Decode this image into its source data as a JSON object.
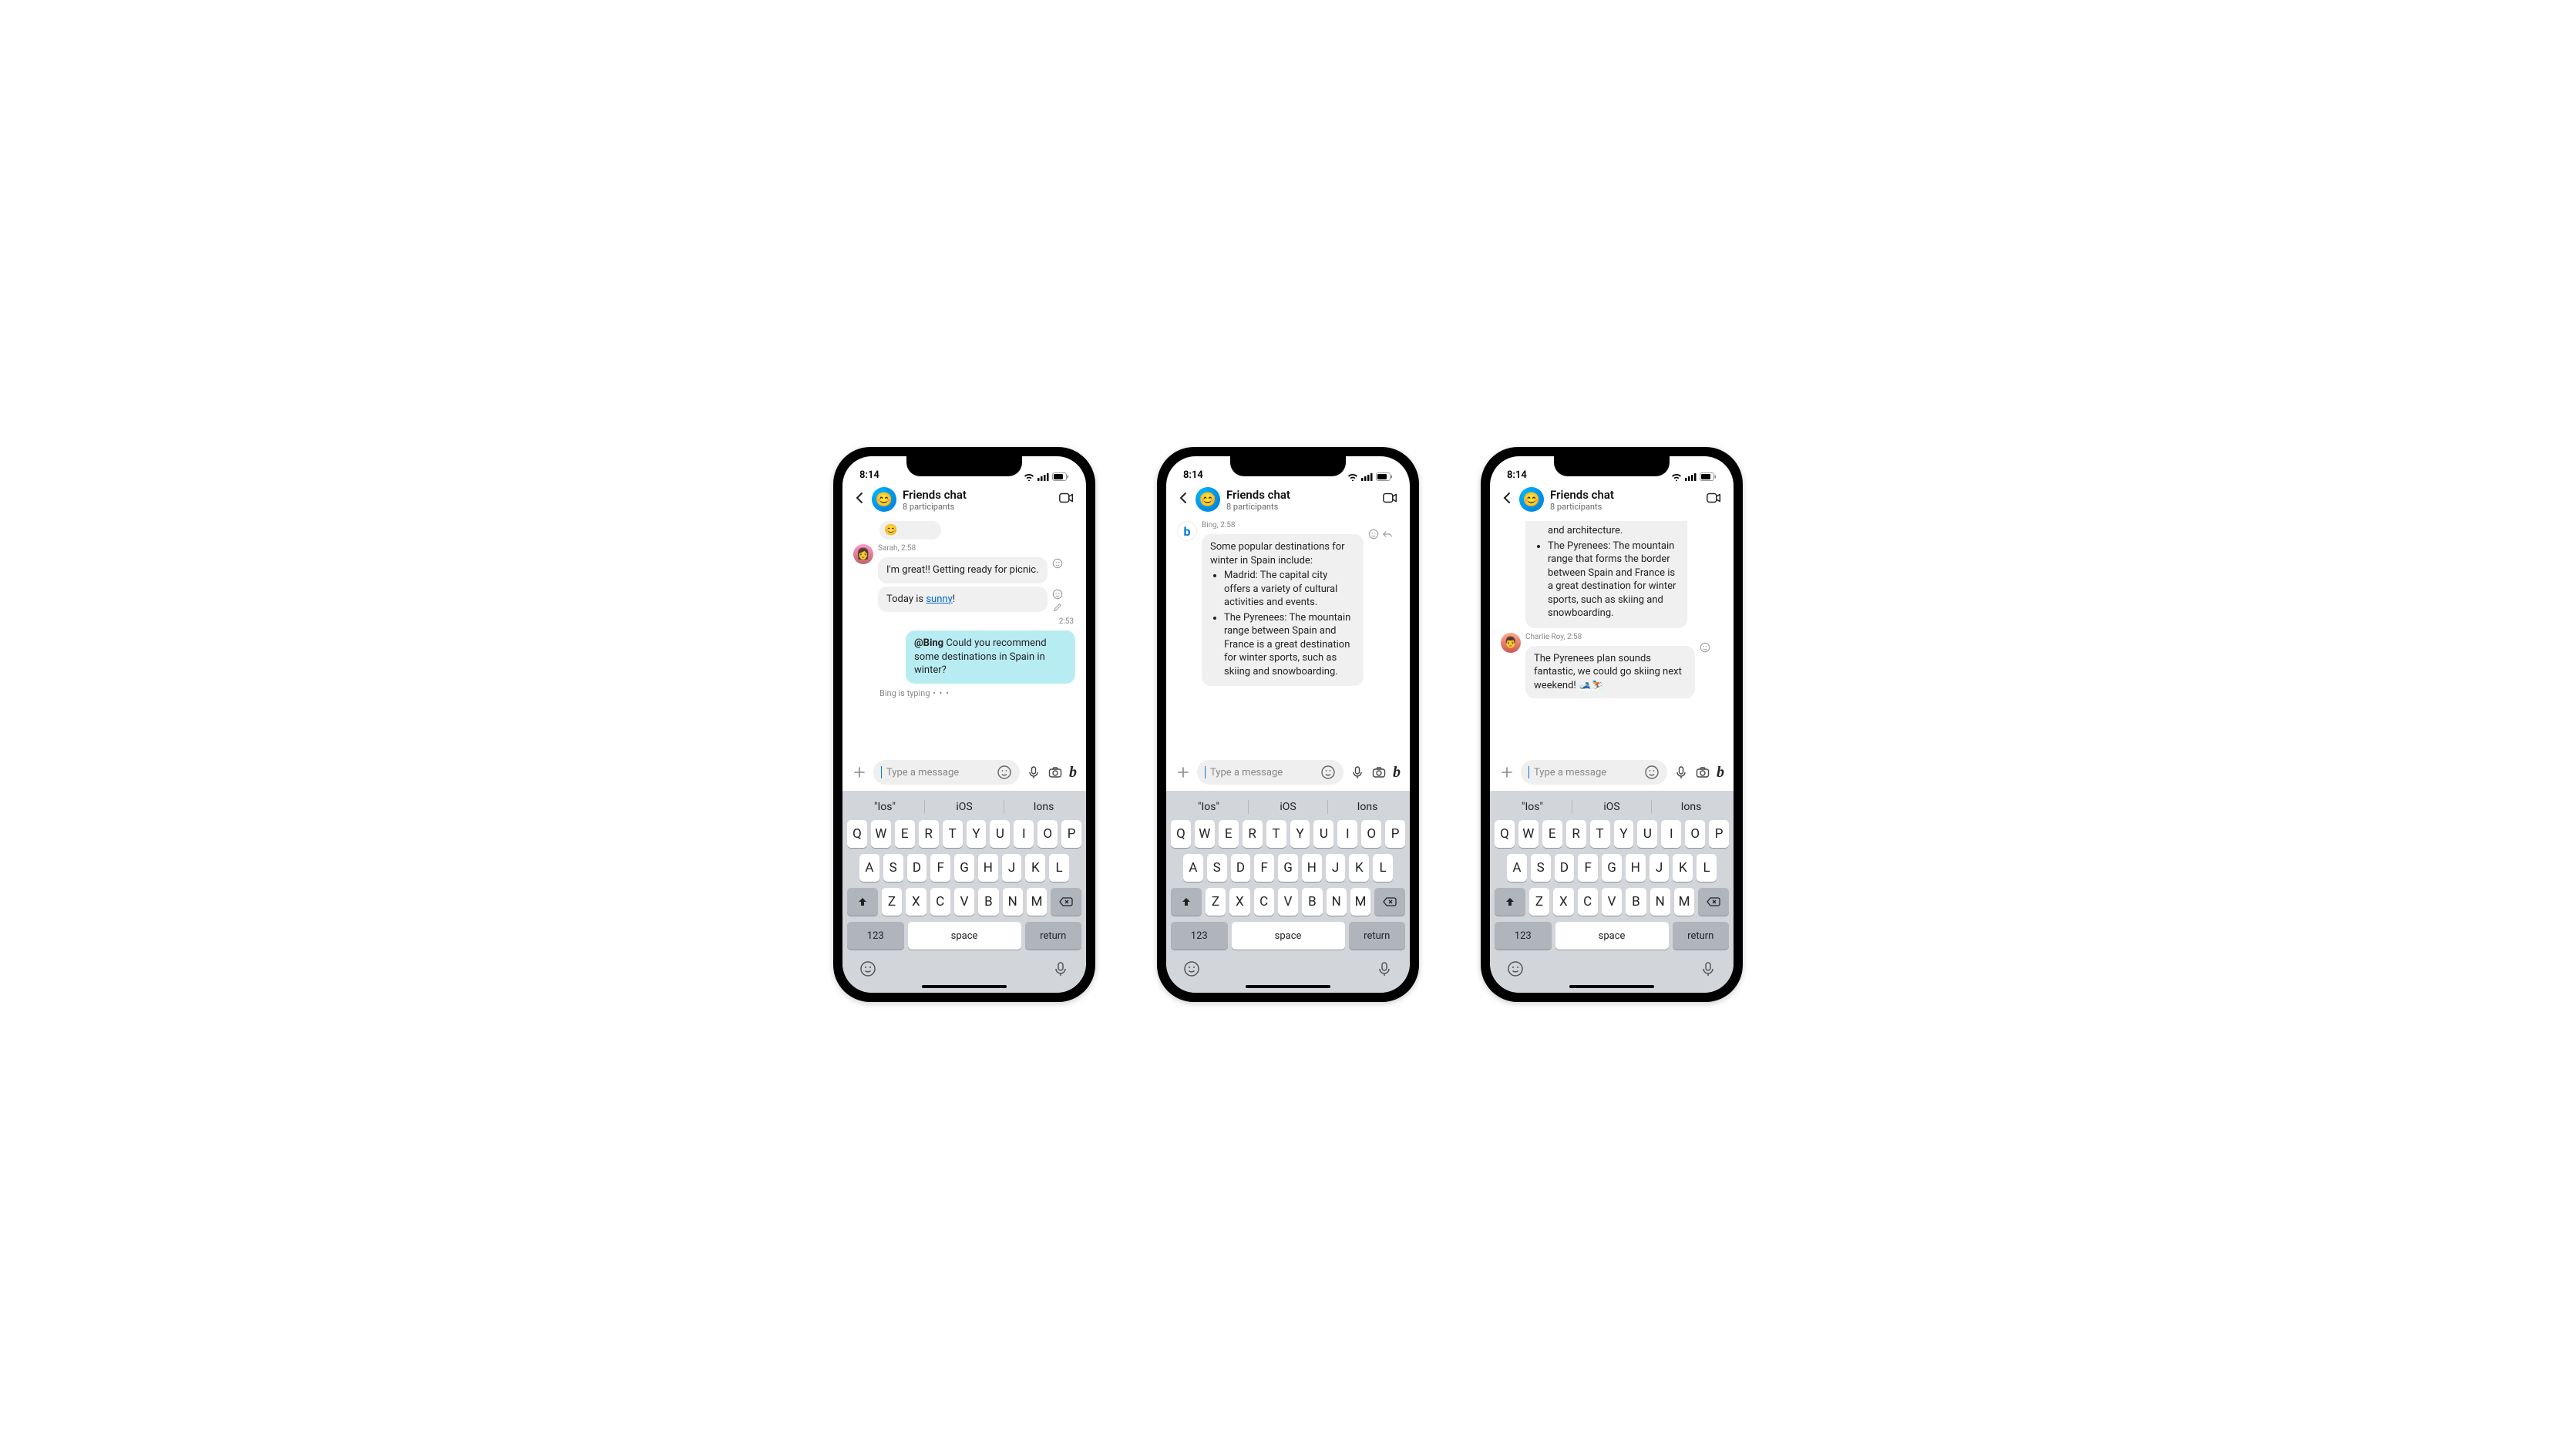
{
  "status": {
    "time": "8:14"
  },
  "header": {
    "title": "Friends chat",
    "subtitle": "8 participants"
  },
  "input": {
    "placeholder": "Type a message"
  },
  "keyboard": {
    "suggestions": [
      "\"Ios\"",
      "iOS",
      "Ions"
    ],
    "row1": [
      "Q",
      "W",
      "E",
      "R",
      "T",
      "Y",
      "U",
      "I",
      "O",
      "P"
    ],
    "row2": [
      "A",
      "S",
      "D",
      "F",
      "G",
      "H",
      "J",
      "K",
      "L"
    ],
    "row3": [
      "Z",
      "X",
      "C",
      "V",
      "B",
      "N",
      "M"
    ],
    "num": "123",
    "space": "space",
    "return": "return"
  },
  "p1": {
    "sarah": {
      "sender": "Sarah, 2:58",
      "msg1_a": "I'm great!! Getting ready for picnic.",
      "msg2_a": "Today is ",
      "msg2_link": "sunny",
      "msg2_b": "!"
    },
    "out": {
      "time": "2:53",
      "mention": "@Bing",
      "body": " Could you recommend some destinations in Spain in winter?"
    },
    "typing": "Bing is typing"
  },
  "p2": {
    "bing": {
      "sender": "Bing, 2:58",
      "intro": "Some popular destinations for winter in Spain include:",
      "item1": "Madrid: The capital city offers a variety of cultural activities and events.",
      "item2": "The Pyrenees: The mountain range between Spain and France is a great destination for winter sports, such as skiing and snowboarding."
    }
  },
  "p3": {
    "cont": {
      "line1": "and architecture.",
      "item": "The Pyrenees: The mountain range that forms the border between Spain and France is a great destination for winter sports, such as skiing and snowboarding."
    },
    "charlie": {
      "sender": "Charlie Roy, 2:58",
      "body": "The Pyrenees plan sounds fantastic, we could go skiing next weekend! 🎿⛷️"
    }
  }
}
